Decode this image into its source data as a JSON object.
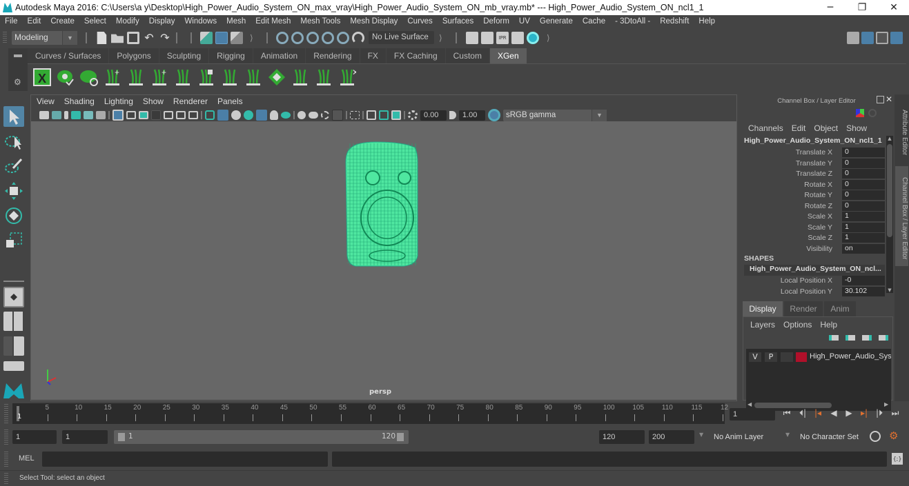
{
  "titlebar": {
    "title": "Autodesk Maya 2016: C:\\Users\\a y\\Desktop\\High_Power_Audio_System_ON_max_vray\\High_Power_Audio_System_ON_mb_vray.mb*   ---   High_Power_Audio_System_ON_ncl1_1",
    "minimize": "─",
    "maximize": "❐",
    "close": "✕"
  },
  "menubar": [
    "File",
    "Edit",
    "Create",
    "Select",
    "Modify",
    "Display",
    "Windows",
    "Mesh",
    "Edit Mesh",
    "Mesh Tools",
    "Mesh Display",
    "Curves",
    "Surfaces",
    "Deform",
    "UV",
    "Generate",
    "Cache",
    "- 3DtoAll -",
    "Redshift",
    "Help"
  ],
  "statusline": {
    "menuset": "Modeling",
    "live_surface": "No Live Surface"
  },
  "shelf": {
    "tabs": [
      "Curves / Surfaces",
      "Polygons",
      "Sculpting",
      "Rigging",
      "Animation",
      "Rendering",
      "FX",
      "FX Caching",
      "Custom",
      "XGen"
    ],
    "active_tab": "XGen",
    "icons": [
      "xgen-window-icon",
      "xgen-preview-icon",
      "xgen-clear-preview-icon",
      "add-guides-icon",
      "place-guides-icon",
      "add-guide-icon",
      "sculpt-guide-icon",
      "lock-guide-icon",
      "rebuild-guides-icon",
      "groom-icon",
      "guide-direction-icon",
      "select-guides-icon",
      "guide-bounds-icon",
      "delete-guides-icon"
    ]
  },
  "toolbox": {
    "tools": [
      "select-tool-icon",
      "lasso-tool-icon",
      "paint-select-icon",
      "move-tool-icon",
      "rotate-tool-icon",
      "scale-tool-icon"
    ],
    "layouts": [
      "single-view-icon",
      "four-view-icon",
      "side-by-side-icon",
      "stacked-view-icon"
    ]
  },
  "viewport": {
    "menu": [
      "View",
      "Shading",
      "Lighting",
      "Show",
      "Renderer",
      "Panels"
    ],
    "exposure": "0.00",
    "gamma": "1.00",
    "color_space": "sRGB gamma",
    "camera_label": "persp",
    "wire_color": "#4fe7a0"
  },
  "channelbox": {
    "title": "Channel Box / Layer Editor",
    "menu": [
      "Channels",
      "Edit",
      "Object",
      "Show"
    ],
    "object_name": "High_Power_Audio_System_ON_ncl1_1",
    "attributes": [
      {
        "label": "Translate X",
        "value": "0"
      },
      {
        "label": "Translate Y",
        "value": "0"
      },
      {
        "label": "Translate Z",
        "value": "0"
      },
      {
        "label": "Rotate X",
        "value": "0"
      },
      {
        "label": "Rotate Y",
        "value": "0"
      },
      {
        "label": "Rotate Z",
        "value": "0"
      },
      {
        "label": "Scale X",
        "value": "1"
      },
      {
        "label": "Scale Y",
        "value": "1"
      },
      {
        "label": "Scale Z",
        "value": "1"
      },
      {
        "label": "Visibility",
        "value": "on"
      }
    ],
    "shapes_header": "SHAPES",
    "shape_name": "High_Power_Audio_System_ON_ncl...",
    "shape_attributes": [
      {
        "label": "Local Position X",
        "value": "-0"
      },
      {
        "label": "Local Position Y",
        "value": "30.102"
      }
    ]
  },
  "side_tabs": [
    "Attribute Editor",
    "Channel Box / Layer Editor"
  ],
  "layer_editor": {
    "tabs": [
      "Display",
      "Render",
      "Anim"
    ],
    "active_tab": "Display",
    "menu": [
      "Layers",
      "Options",
      "Help"
    ],
    "layers": [
      {
        "v": "V",
        "p": "P",
        "color": "#b0102a",
        "name": "High_Power_Audio_Syste"
      }
    ]
  },
  "timeline": {
    "ticks": [
      "5",
      "10",
      "15",
      "20",
      "25",
      "30",
      "35",
      "40",
      "45",
      "50",
      "55",
      "60",
      "65",
      "70",
      "75",
      "80",
      "85",
      "90",
      "95",
      "100",
      "105",
      "110",
      "115",
      "12"
    ],
    "current_frame_marker": "1",
    "current_frame": "1"
  },
  "range": {
    "start": "1",
    "playback_start": "1",
    "slider_start": "1",
    "slider_end": "120",
    "playback_end": "120",
    "end": "200",
    "anim_layer": "No Anim Layer",
    "character_set": "No Character Set"
  },
  "cmdline": {
    "label": "MEL"
  },
  "helpline": {
    "text": "Select Tool: select an object"
  }
}
